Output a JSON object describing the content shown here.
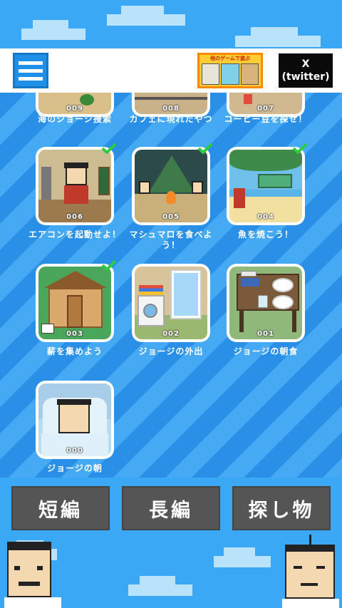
{
  "header": {
    "ad_title": "他のゲームで遊ぶ",
    "twitter_line1": "X",
    "twitter_line2": "(twitter)"
  },
  "levels": [
    {
      "num": "009",
      "title": "海のジョージ捜索",
      "cleared": false
    },
    {
      "num": "008",
      "title": "カフェに現れたやつ",
      "cleared": false
    },
    {
      "num": "007",
      "title": "コーヒー豆を探せ！",
      "cleared": false
    },
    {
      "num": "006",
      "title": "エアコンを起動せよ！",
      "cleared": true
    },
    {
      "num": "005",
      "title": "マシュマロを食べよう！",
      "cleared": true
    },
    {
      "num": "004",
      "title": "魚を焼こう！",
      "cleared": true
    },
    {
      "num": "003",
      "title": "薪を集めよう",
      "cleared": true
    },
    {
      "num": "002",
      "title": "ジョージの外出",
      "cleared": false
    },
    {
      "num": "001",
      "title": "ジョージの朝食",
      "cleared": false
    },
    {
      "num": "000",
      "title": "ジョージの朝",
      "cleared": false
    }
  ],
  "categories": {
    "short": "短編",
    "long": "長編",
    "search": "探し物"
  },
  "colors": {
    "accent_blue": "#1e90e8",
    "check_green": "#2ecc40",
    "button_gray": "#555555"
  }
}
